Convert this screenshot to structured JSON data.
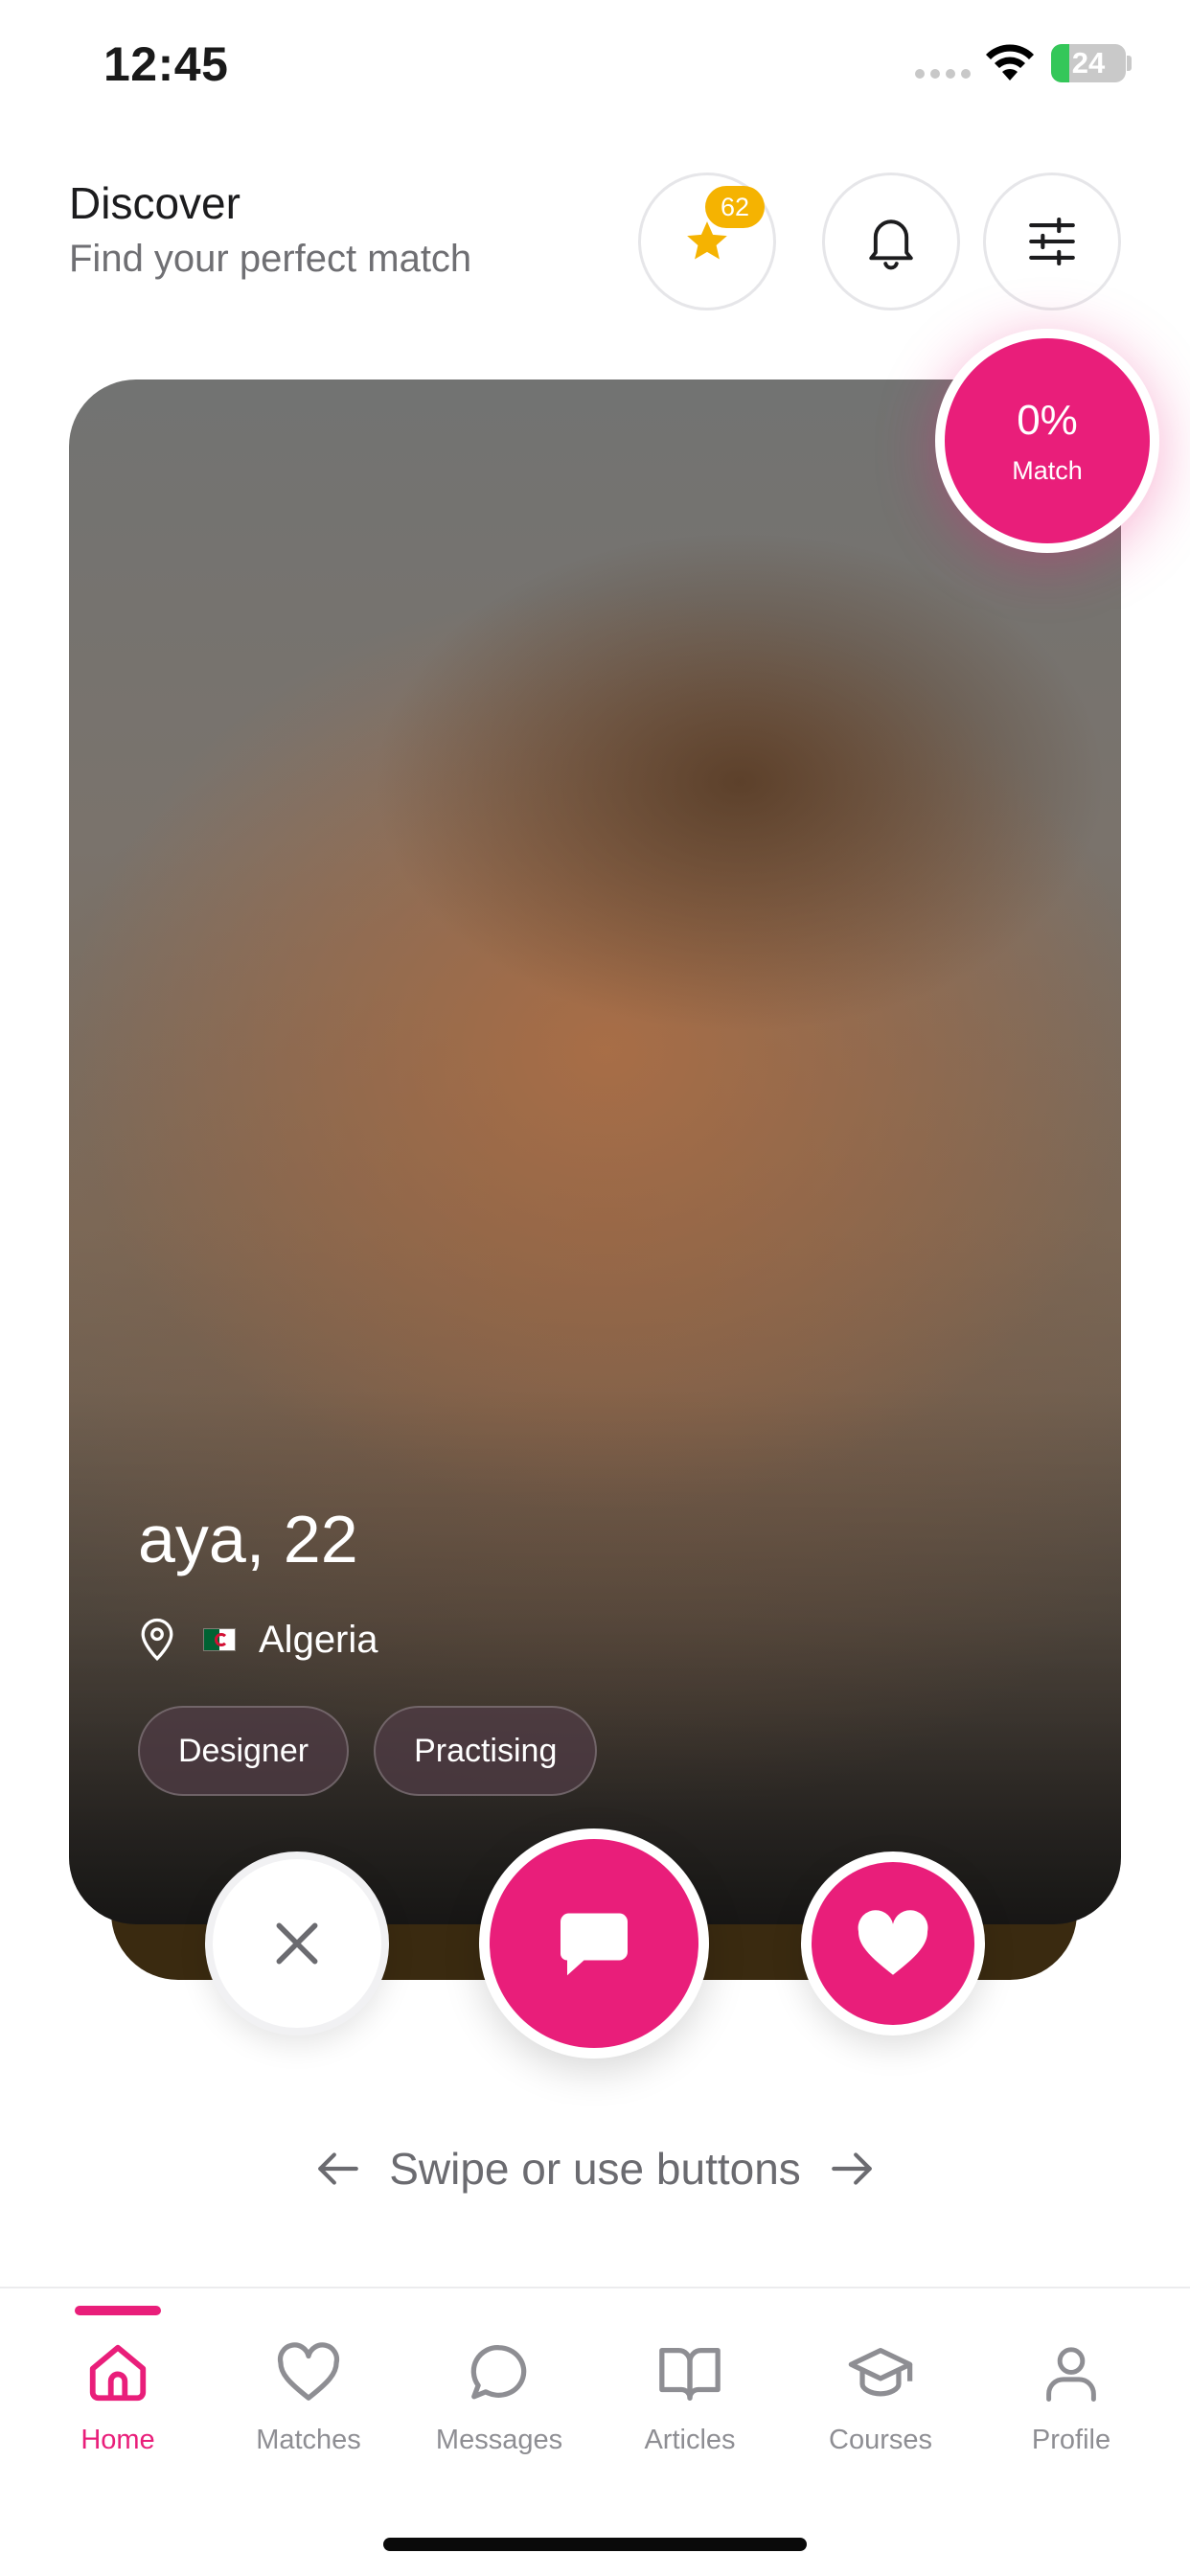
{
  "status_bar": {
    "time": "12:45",
    "battery": "24",
    "battery_level": 0.24
  },
  "header": {
    "title": "Discover",
    "subtitle": "Find your perfect match",
    "favorites_badge": "62"
  },
  "card": {
    "name_age": "aya, 22",
    "location": "Algeria",
    "tags": [
      "Designer",
      "Practising"
    ],
    "match_percent": "0%",
    "match_label": "Match"
  },
  "hint": {
    "text": "Swipe or use buttons"
  },
  "nav": {
    "active": "Home",
    "items": [
      {
        "label": "Home",
        "icon": "home-icon"
      },
      {
        "label": "Matches",
        "icon": "heart-icon"
      },
      {
        "label": "Messages",
        "icon": "chat-bubble-icon"
      },
      {
        "label": "Articles",
        "icon": "book-icon"
      },
      {
        "label": "Courses",
        "icon": "graduation-cap-icon"
      },
      {
        "label": "Profile",
        "icon": "person-icon"
      }
    ]
  },
  "colors": {
    "accent": "#e91e7a",
    "badge": "#f5b301",
    "battery_green": "#34c759"
  }
}
